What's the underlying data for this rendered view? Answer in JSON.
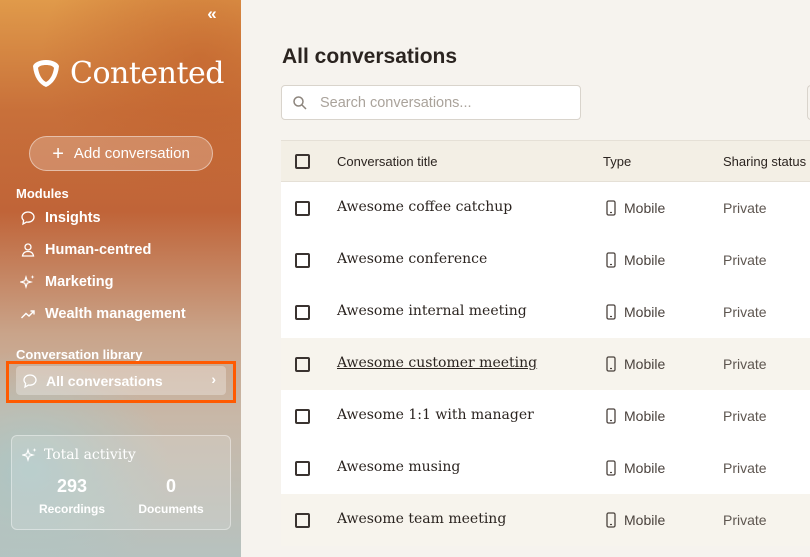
{
  "sidebar": {
    "collapse_glyph": "«",
    "brand": "Contented",
    "add_button": "Add conversation",
    "modules_label": "Modules",
    "modules": [
      {
        "label": "Insights",
        "icon": "chat-bubble-icon"
      },
      {
        "label": "Human-centred",
        "icon": "person-icon"
      },
      {
        "label": "Marketing",
        "icon": "sparkle-icon"
      },
      {
        "label": "Wealth management",
        "icon": "trend-up-icon"
      }
    ],
    "library_label": "Conversation library",
    "library_item": "All conversations",
    "activity": {
      "title": "Total activity",
      "recordings_value": "293",
      "recordings_label": "Recordings",
      "documents_value": "0",
      "documents_label": "Documents"
    }
  },
  "main": {
    "title": "All conversations",
    "search_placeholder": "Search conversations...",
    "columns": [
      "Conversation title",
      "Type",
      "Sharing status"
    ],
    "rows": [
      {
        "title": "Awesome coffee catchup",
        "type": "Mobile",
        "sharing": "Private"
      },
      {
        "title": "Awesome conference",
        "type": "Mobile",
        "sharing": "Private"
      },
      {
        "title": "Awesome internal meeting",
        "type": "Mobile",
        "sharing": "Private"
      },
      {
        "title": "Awesome customer meeting",
        "type": "Mobile",
        "sharing": "Private"
      },
      {
        "title": "Awesome 1:1 with manager",
        "type": "Mobile",
        "sharing": "Private"
      },
      {
        "title": "Awesome musing",
        "type": "Mobile",
        "sharing": "Private"
      },
      {
        "title": "Awesome team meeting",
        "type": "Mobile",
        "sharing": "Private"
      }
    ]
  },
  "colors": {
    "highlight_frame": "#ff5a00",
    "sidebar_orange": "#c8703a",
    "page_bg": "#f6f3ee"
  }
}
